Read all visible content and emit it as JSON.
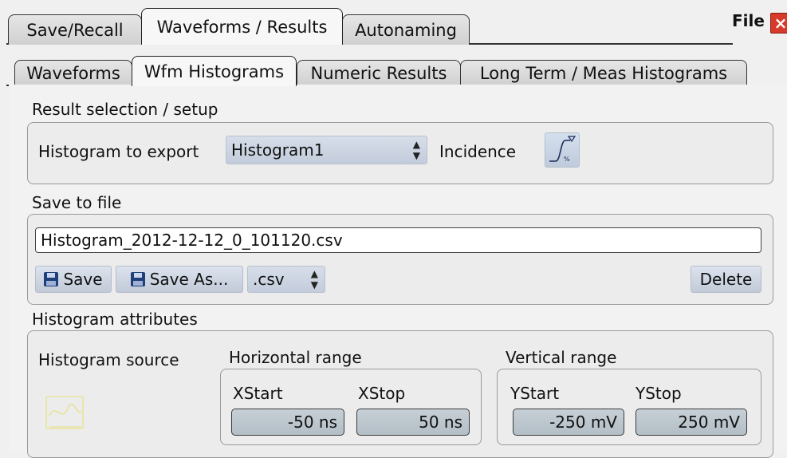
{
  "window": {
    "title": "File",
    "top_tabs": [
      "Save/Recall",
      "Waveforms / Results",
      "Autonaming"
    ],
    "active_top_tab": "Waveforms / Results",
    "sub_tabs": [
      "Waveforms",
      "Wfm Histograms",
      "Numeric Results",
      "Long Term / Meas Histograms"
    ],
    "active_sub_tab": "Wfm Histograms"
  },
  "result_selection": {
    "title": "Result selection / setup",
    "histogram_label": "Histogram to export",
    "histogram_value": "Histogram1",
    "incidence_label": "Incidence",
    "incidence_icon": "incidence-icon",
    "incidence_icon_text": "%"
  },
  "save_to_file": {
    "title": "Save to file",
    "filename": "Histogram_2012-12-12_0_101120.csv",
    "save_label": "Save",
    "save_as_label": "Save As...",
    "format_value": ".csv",
    "delete_label": "Delete",
    "save_icon": "floppy-disk-icon"
  },
  "histogram_attributes": {
    "title": "Histogram attributes",
    "source_label": "Histogram source",
    "source_icon": "histogram-source-icon",
    "horizontal": {
      "title": "Horizontal range",
      "xstart_label": "XStart",
      "xstart_value": "-50 ns",
      "xstop_label": "XStop",
      "xstop_value": "50 ns"
    },
    "vertical": {
      "title": "Vertical range",
      "ystart_label": "YStart",
      "ystart_value": "-250 mV",
      "ystop_label": "YStop",
      "ystop_value": "250 mV"
    }
  },
  "colors": {
    "accent_select": "#c3ccdb",
    "close_button": "#d63a2a",
    "value_box": "#b3bec6"
  }
}
